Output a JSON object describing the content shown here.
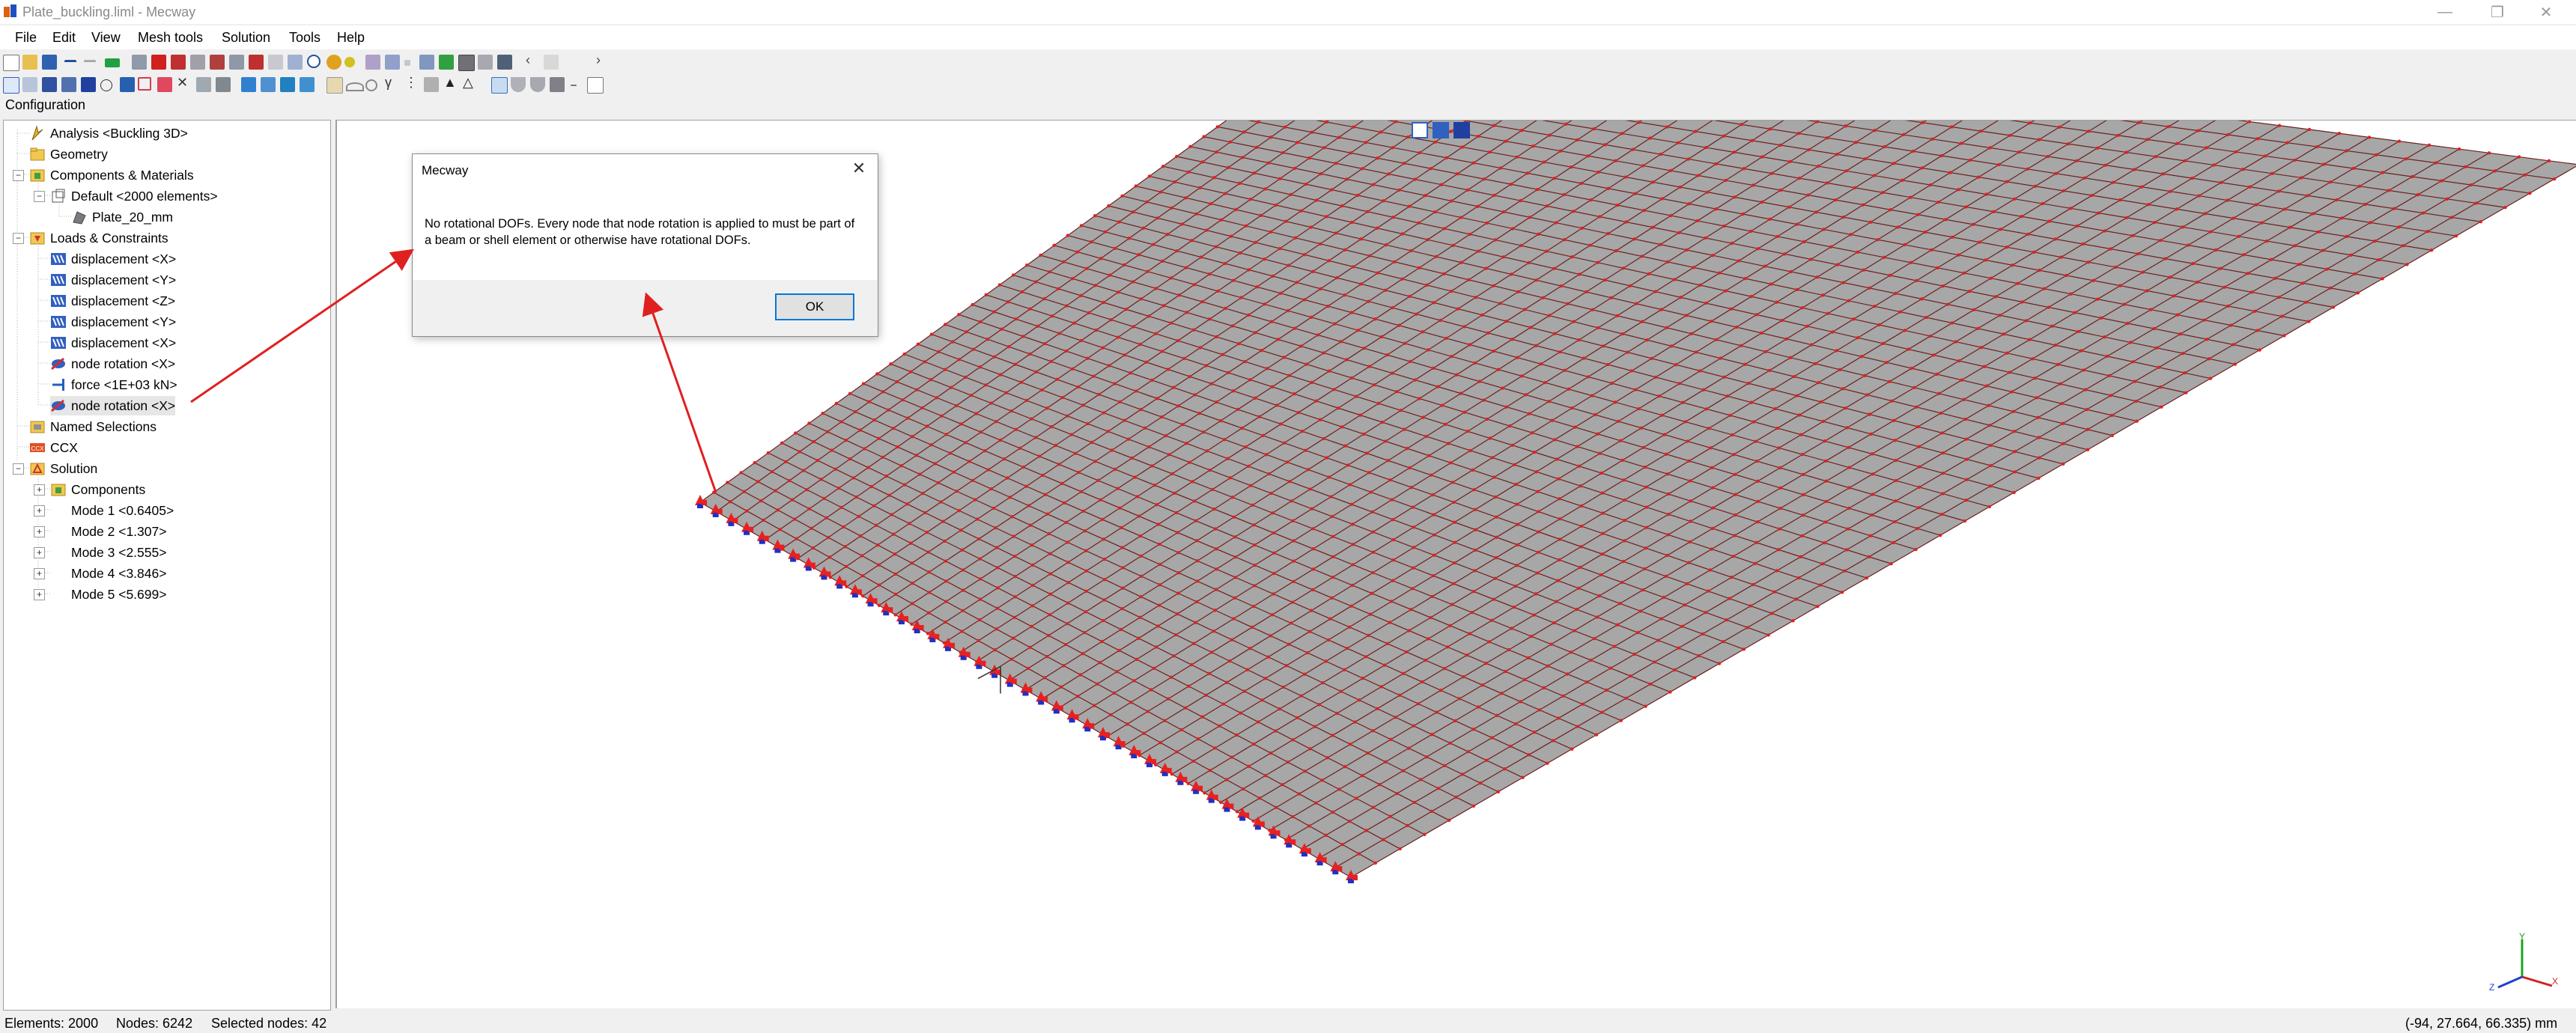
{
  "window": {
    "title": "Plate_buckling.liml - Mecway"
  },
  "menu": [
    "File",
    "Edit",
    "View",
    "Mesh tools",
    "Solution",
    "Tools",
    "Help"
  ],
  "config_label": "Configuration",
  "tree": {
    "analysis": "Analysis <Buckling 3D>",
    "geometry": "Geometry",
    "components_materials": "Components & Materials",
    "default_component": "Default <2000 elements>",
    "plate": "Plate_20_mm",
    "loads_constraints": "Loads & Constraints",
    "loads": [
      "displacement <X>",
      "displacement <Y>",
      "displacement <Z>",
      "displacement <Y>",
      "displacement <X>",
      "node rotation <X>",
      "force <1E+03 kN>",
      "node rotation <X>"
    ],
    "named_selections": "Named Selections",
    "ccx": "CCX",
    "solution": "Solution",
    "components": "Components",
    "modes": [
      "Mode 1 <0.6405>",
      "Mode 2 <1.307>",
      "Mode 3 <2.555>",
      "Mode 4 <3.846>",
      "Mode 5 <5.699>"
    ]
  },
  "dialog": {
    "title": "Mecway",
    "message": "No rotational DOFs. Every node that node rotation is applied to must be part of a beam or shell element or otherwise have rotational DOFs.",
    "ok": "OK"
  },
  "status": {
    "elements": "Elements: 2000",
    "nodes": "Nodes: 6242",
    "selected": "Selected nodes: 42",
    "coords": "(-94, 27.664, 66.335) mm"
  },
  "colors": {
    "mesh_fill": "#a7a7a7",
    "mesh_lines": "#6e1f1f",
    "node_marks": "#e32020",
    "annotation_arrow": "#e02020",
    "ok_border": "#0078d7"
  },
  "icons": {
    "window": [
      "app-icon",
      "minimize-icon",
      "restore-icon",
      "close-icon"
    ],
    "tree": [
      "analysis-icon",
      "folder-icon",
      "components-icon",
      "element-icon",
      "plate-icon",
      "loads-icon",
      "displacement-icon",
      "node-rotation-icon",
      "force-icon",
      "named-selections-icon",
      "ccx-icon",
      "solution-icon",
      "mode-icon"
    ]
  }
}
